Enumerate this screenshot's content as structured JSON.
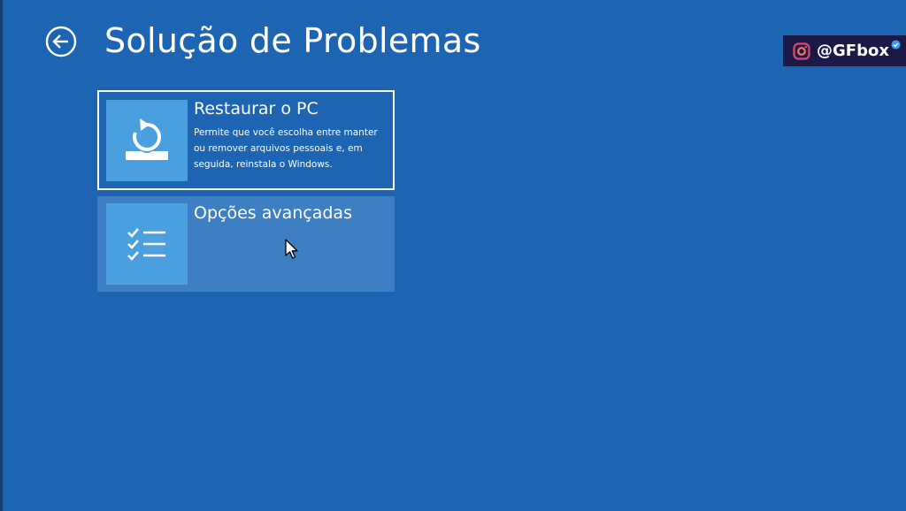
{
  "header": {
    "title": "Solução de Problemas",
    "back_icon": "back-arrow-icon"
  },
  "watermark": {
    "handle": "@GFbox",
    "icon": "instagram-icon",
    "badge_icon": "verified-badge-icon"
  },
  "options": [
    {
      "title": "Restaurar o PC",
      "description": "Permite que você escolha entre manter ou remover arquivos pessoais e, em seguida, reinstala o Windows.",
      "icon": "reset-pc-icon",
      "selected": true
    },
    {
      "title": "Opções avançadas",
      "description": "",
      "icon": "checklist-icon",
      "hovered": true
    }
  ],
  "colors": {
    "background": "#1d65b2",
    "tile_icon_bg": "#4a9fdf",
    "tile_hover_bg": "#3e7fc3",
    "watermark_bg": "#1b1a47"
  }
}
